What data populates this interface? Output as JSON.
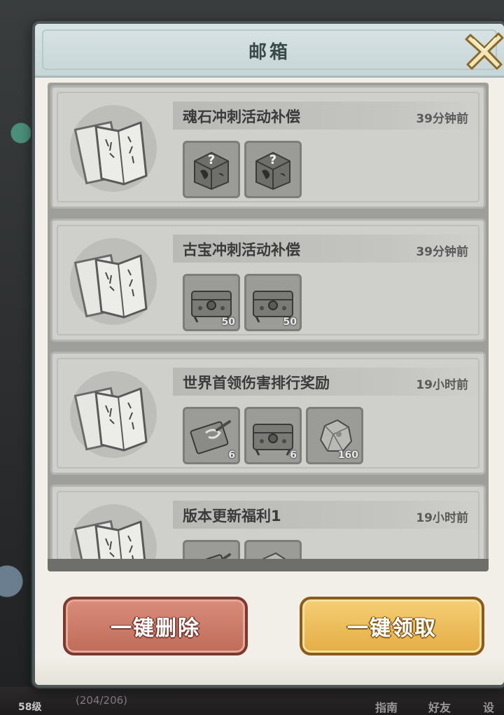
{
  "modal": {
    "title": "邮箱"
  },
  "mails": [
    {
      "title": "魂石冲刺活动补偿",
      "time": "39分钟前",
      "rewards": [
        {
          "icon": "mystery-chest-icon",
          "count": ""
        },
        {
          "icon": "mystery-chest-icon",
          "count": ""
        }
      ]
    },
    {
      "title": "古宝冲刺活动补偿",
      "time": "39分钟前",
      "rewards": [
        {
          "icon": "treasure-chest-icon",
          "count": "50"
        },
        {
          "icon": "treasure-chest-icon",
          "count": "50"
        }
      ]
    },
    {
      "title": "世界首领伤害排行奖励",
      "time": "19小时前",
      "rewards": [
        {
          "icon": "scroll-card-icon",
          "count": "6"
        },
        {
          "icon": "treasure-chest-icon",
          "count": "6"
        },
        {
          "icon": "ore-stone-icon",
          "count": "160"
        }
      ]
    },
    {
      "title": "版本更新福利1",
      "time": "19小时前",
      "rewards": [
        {
          "icon": "scroll-card-icon",
          "count": ""
        },
        {
          "icon": "ore-stone-icon",
          "count": ""
        }
      ]
    }
  ],
  "buttons": {
    "delete_all": "一键删除",
    "claim_all": "一键领取"
  },
  "background": {
    "level": "58级",
    "counter": "(204/206)",
    "nav_guide": "指南",
    "nav_friends": "好友",
    "nav_settings": "设"
  },
  "colors": {
    "modal_bg": "#f1efe8",
    "header_bg": "#c6d5d6",
    "mail_card_bg": "#cfcfcc",
    "delete_button": "#c06c5a",
    "claim_button": "#e4ad45"
  }
}
